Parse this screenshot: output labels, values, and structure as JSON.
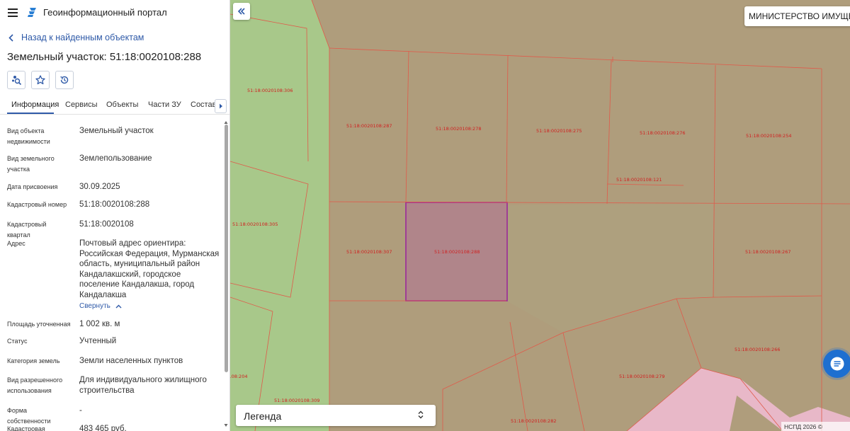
{
  "header": {
    "app_title": "Геоинформационный портал"
  },
  "navigation": {
    "back_label": "Назад к найденным объектам"
  },
  "object": {
    "title": "Земельный участок: 51:18:0020108:288"
  },
  "tabs": [
    {
      "label": "Информация",
      "active": true
    },
    {
      "label": "Сервисы"
    },
    {
      "label": "Объекты"
    },
    {
      "label": "Части ЗУ"
    },
    {
      "label": "Состав"
    }
  ],
  "properties": [
    {
      "label": "Вид объекта недвижимости",
      "value": "Земельный участок"
    },
    {
      "label": "Вид земельного участка",
      "value": "Землепользование"
    },
    {
      "label": "Дата присвоения",
      "value": "30.09.2025"
    },
    {
      "label": "Кадастровый номер",
      "value": "51:18:0020108:288"
    },
    {
      "label": "Кадастровый квартал",
      "value": "51:18:0020108"
    },
    {
      "label": "Адрес",
      "value": "Почтовый адрес ориентира: Российская Федерация, Мурманская область, муниципальный район Кандалакшский, городское поселение Кандалакша, город Кандалакша"
    },
    {
      "label": "Площадь уточненная",
      "value": "1 002 кв. м"
    },
    {
      "label": "Статус",
      "value": "Учтенный"
    },
    {
      "label": "Категория земель",
      "value": "Земли населенных пунктов"
    },
    {
      "label": "Вид разрешенного использования",
      "value": "Для индивидуального жилищного строительства"
    },
    {
      "label": "Форма собственности",
      "value": "-"
    },
    {
      "label": "Кадастровая стоимость",
      "value": "483 465 руб."
    }
  ],
  "address_toggle_label": "Свернуть",
  "map": {
    "org_selector": "МИНИСТЕРСТВО ИМУЩЕС...",
    "legend_label": "Легенда",
    "copyright": "НСПД 2026 ©",
    "parcels": [
      "51:18:0020108:306",
      "51:18:0020108:287",
      "51:18:0020108:278",
      "51:18:0020108:275",
      "51:18:0020108:276",
      "51:18:0020108:254",
      "51:18:0020108:121",
      "51:18:0020108:305",
      "51:18:0020108:307",
      "51:18:0020108:288",
      "51:18:0020108:267",
      "51:18:0020108:266",
      "51:18:0020108:279",
      "51:18:0020108:204",
      "51:18:0020108:309",
      "51:18:0020108:282"
    ]
  },
  "colors": {
    "accent": "#2f5aa8",
    "parcel_fill": "#af9d7c",
    "green_zone": "#a8c88a",
    "selected_parcel": "#b0858a",
    "selected_border": "#9a2a9a",
    "pink_zone": "#e8b8c8",
    "parcel_border": "#e05a4a",
    "chat_button": "#1e6fd0"
  },
  "icons": {
    "menu": "hamburger-icon",
    "logo": "portal-logo-icon",
    "back": "chevron-left-icon",
    "tools": [
      "map-search-icon",
      "star-icon",
      "history-icon"
    ],
    "tab_scroll": "caret-right-icon",
    "panel_collapse": "double-chevron-left-icon",
    "legend": "sort-arrows-icon",
    "chat": "chat-bubble-icon"
  }
}
